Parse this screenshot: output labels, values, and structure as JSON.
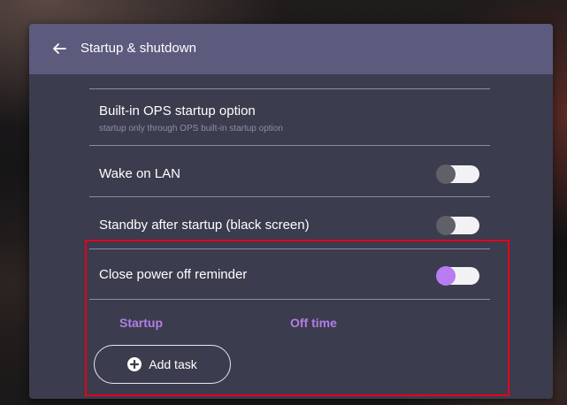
{
  "header": {
    "title": "Startup & shutdown",
    "back_icon": "arrow-left-icon"
  },
  "settings": [
    {
      "label": "Built-in OPS startup option",
      "subtitle": "startup only through OPS built-in startup option"
    },
    {
      "label": "Wake on LAN",
      "toggle_on": false
    },
    {
      "label": "Standby after startup (black screen)",
      "toggle_on": false
    },
    {
      "label": "Close power off reminder",
      "toggle_on": true
    }
  ],
  "schedule": {
    "columns": [
      "Startup",
      "Off time"
    ],
    "add_task_label": "Add task",
    "add_task_icon": "plus-circle-icon"
  },
  "colors": {
    "header": "#5c5b7e",
    "panel": "#3b3c4d",
    "accent": "#b37de8",
    "highlight_box": "#e3001b"
  }
}
